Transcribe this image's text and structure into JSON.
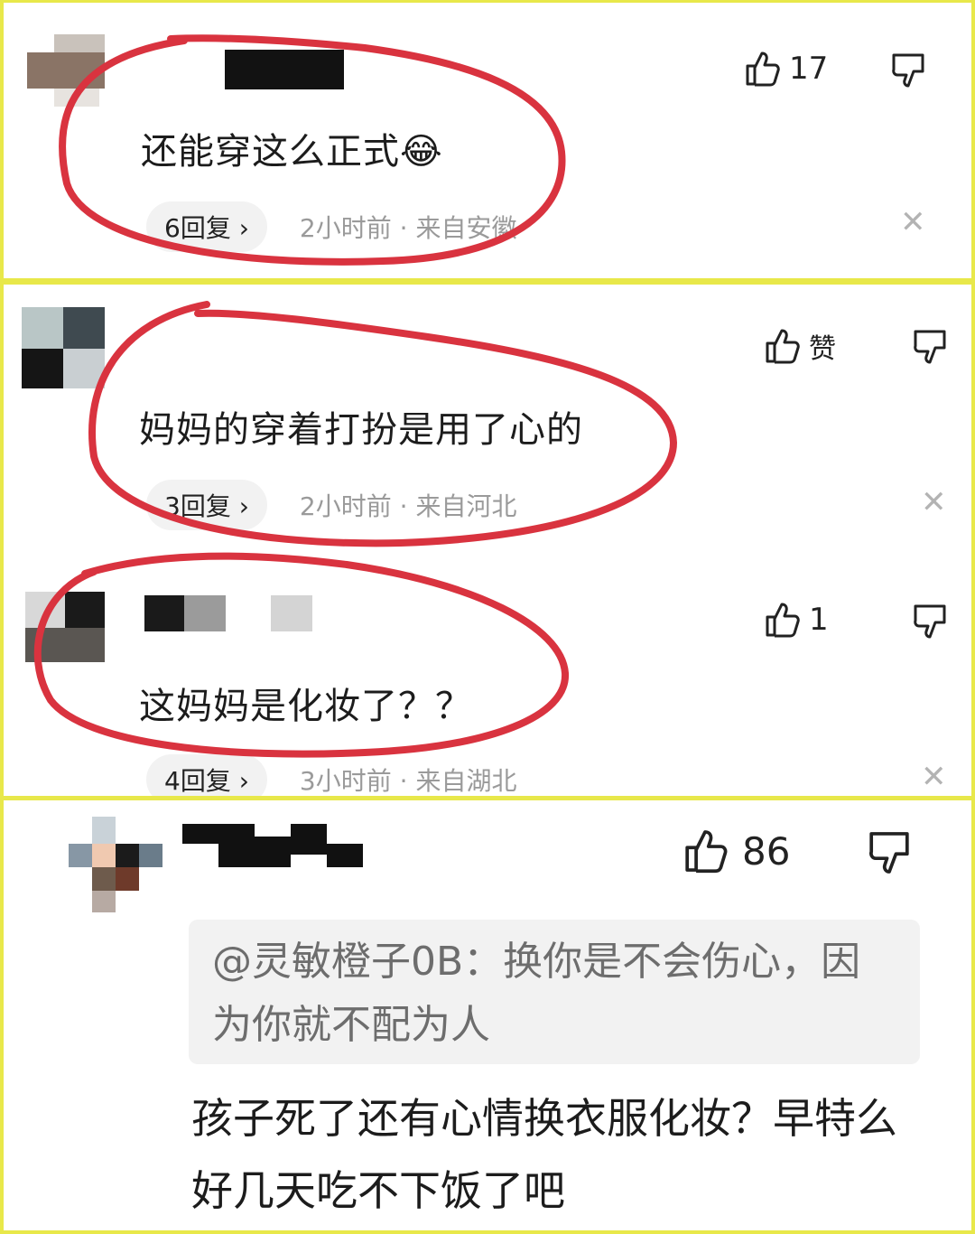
{
  "comments": [
    {
      "text": "还能穿这么正式",
      "emoji": "😂",
      "likes": "17",
      "replies": "6回复 ›",
      "meta": "2小时前 · 来自安徽"
    },
    {
      "text": "妈妈的穿着打扮是用了心的",
      "likes": "赞",
      "replies": "3回复 ›",
      "meta": "2小时前 · 来自河北"
    },
    {
      "text": "这妈妈是化妆了？？",
      "likes": "1",
      "replies": "4回复 ›",
      "meta": "3小时前 · 来自湖北"
    },
    {
      "quote": "@灵敏橙子0B：换你是不会伤心，因为你就不配为人",
      "text": "孩子死了还有心情换衣服化妆？早特么好几天吃不下饭了吧",
      "likes": "86"
    }
  ],
  "icons": {
    "like": "thumbs-up-icon",
    "dislike": "thumbs-down-icon",
    "close": "close-icon"
  },
  "colors": {
    "frame": "#e8e84a",
    "annotation": "#d9333f",
    "meta_text": "#9a9a9a",
    "quote_bg": "#f2f2f2"
  }
}
